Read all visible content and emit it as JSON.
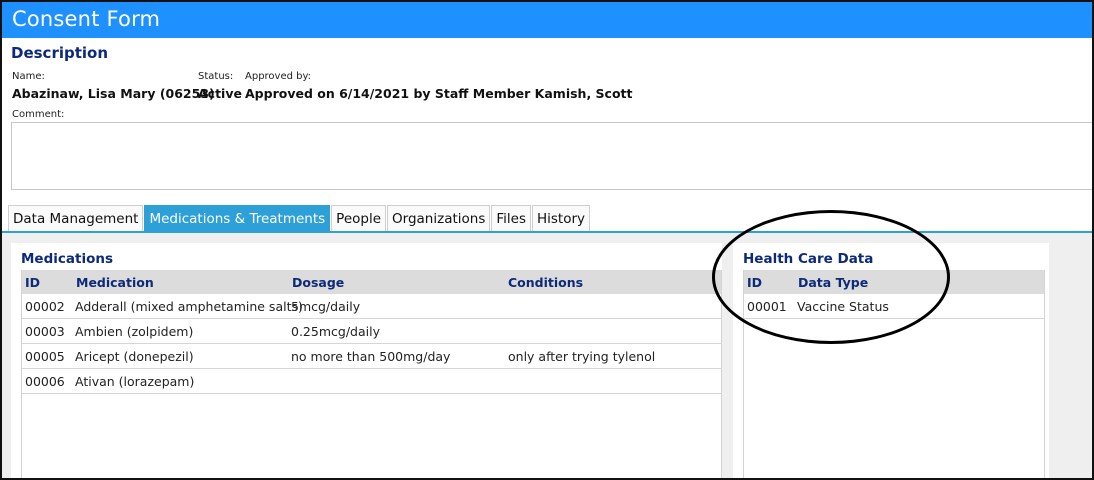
{
  "window": {
    "title": "Consent Form"
  },
  "description": {
    "section_title": "Description",
    "name_label": "Name:",
    "name_value": "Abazinaw, Lisa Mary (06253)",
    "status_label": "Status:",
    "status_value": "Active",
    "approved_label": "Approved by:",
    "approved_value": "Approved on 6/14/2021 by Staff Member Kamish, Scott",
    "comment_label": "Comment:",
    "comment_value": ""
  },
  "tabs": [
    {
      "label": "Data Management",
      "active": false
    },
    {
      "label": "Medications & Treatments",
      "active": true
    },
    {
      "label": "People",
      "active": false
    },
    {
      "label": "Organizations",
      "active": false
    },
    {
      "label": "Files",
      "active": false
    },
    {
      "label": "History",
      "active": false
    }
  ],
  "medications": {
    "title": "Medications",
    "columns": [
      "ID",
      "Medication",
      "Dosage",
      "Conditions"
    ],
    "rows": [
      [
        "00002",
        "Adderall (mixed amphetamine salts)",
        "5mcg/daily",
        ""
      ],
      [
        "00003",
        "Ambien (zolpidem)",
        "0.25mcg/daily",
        ""
      ],
      [
        "00005",
        "Aricept (donepezil)",
        "no more than 500mg/day",
        "only after trying tylenol"
      ],
      [
        "00006",
        "Ativan (lorazepam)",
        "",
        ""
      ]
    ]
  },
  "health_care_data": {
    "title": "Health Care Data",
    "columns": [
      "ID",
      "Data Type"
    ],
    "rows": [
      [
        "00001",
        "Vaccine Status"
      ]
    ]
  },
  "colors": {
    "titlebar": "#1e90ff",
    "active_tab": "#2da0d8",
    "section_title": "#0d2a7a",
    "annotation_circle": "#000000"
  }
}
